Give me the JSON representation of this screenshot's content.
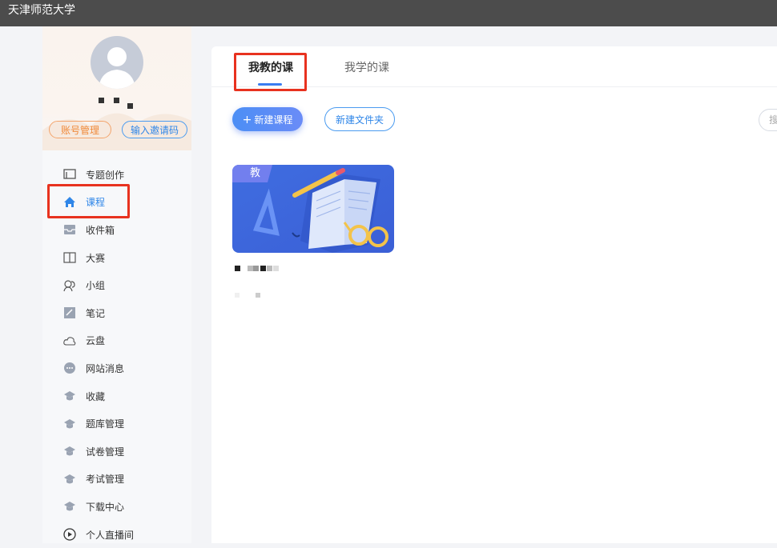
{
  "app": {
    "title": "天津师范大学"
  },
  "sidebar": {
    "account_button": "账号管理",
    "invite_button": "输入邀请码",
    "items": [
      {
        "label": "专题创作",
        "icon": "monitor-icon"
      },
      {
        "label": "课程",
        "icon": "home-icon",
        "active": true
      },
      {
        "label": "收件箱",
        "icon": "inbox-icon"
      },
      {
        "label": "大赛",
        "icon": "book-open-icon"
      },
      {
        "label": "小组",
        "icon": "group-icon"
      },
      {
        "label": "笔记",
        "icon": "note-icon"
      },
      {
        "label": "云盘",
        "icon": "cloud-icon"
      },
      {
        "label": "网站消息",
        "icon": "chat-bubble-icon"
      },
      {
        "label": "收藏",
        "icon": "grad-cap-icon"
      },
      {
        "label": "题库管理",
        "icon": "grad-cap-icon"
      },
      {
        "label": "试卷管理",
        "icon": "grad-cap-icon"
      },
      {
        "label": "考试管理",
        "icon": "grad-cap-icon"
      },
      {
        "label": "下载中心",
        "icon": "grad-cap-icon"
      },
      {
        "label": "个人直播间",
        "icon": "play-circle-icon"
      }
    ]
  },
  "main": {
    "tabs": [
      {
        "label": "我教的课",
        "active": true
      },
      {
        "label": "我学的课",
        "active": false
      }
    ],
    "new_course_button": "新建课程",
    "new_course_icon": "plus-icon",
    "new_folder_button": "新建文件夹",
    "search_button": "搜",
    "course_card": {
      "badge": "教"
    }
  },
  "colors": {
    "accent": "#2f86e8",
    "highlight": "#e8321f",
    "topbar": "#4c4c4c",
    "orange": "#f08a3a"
  }
}
